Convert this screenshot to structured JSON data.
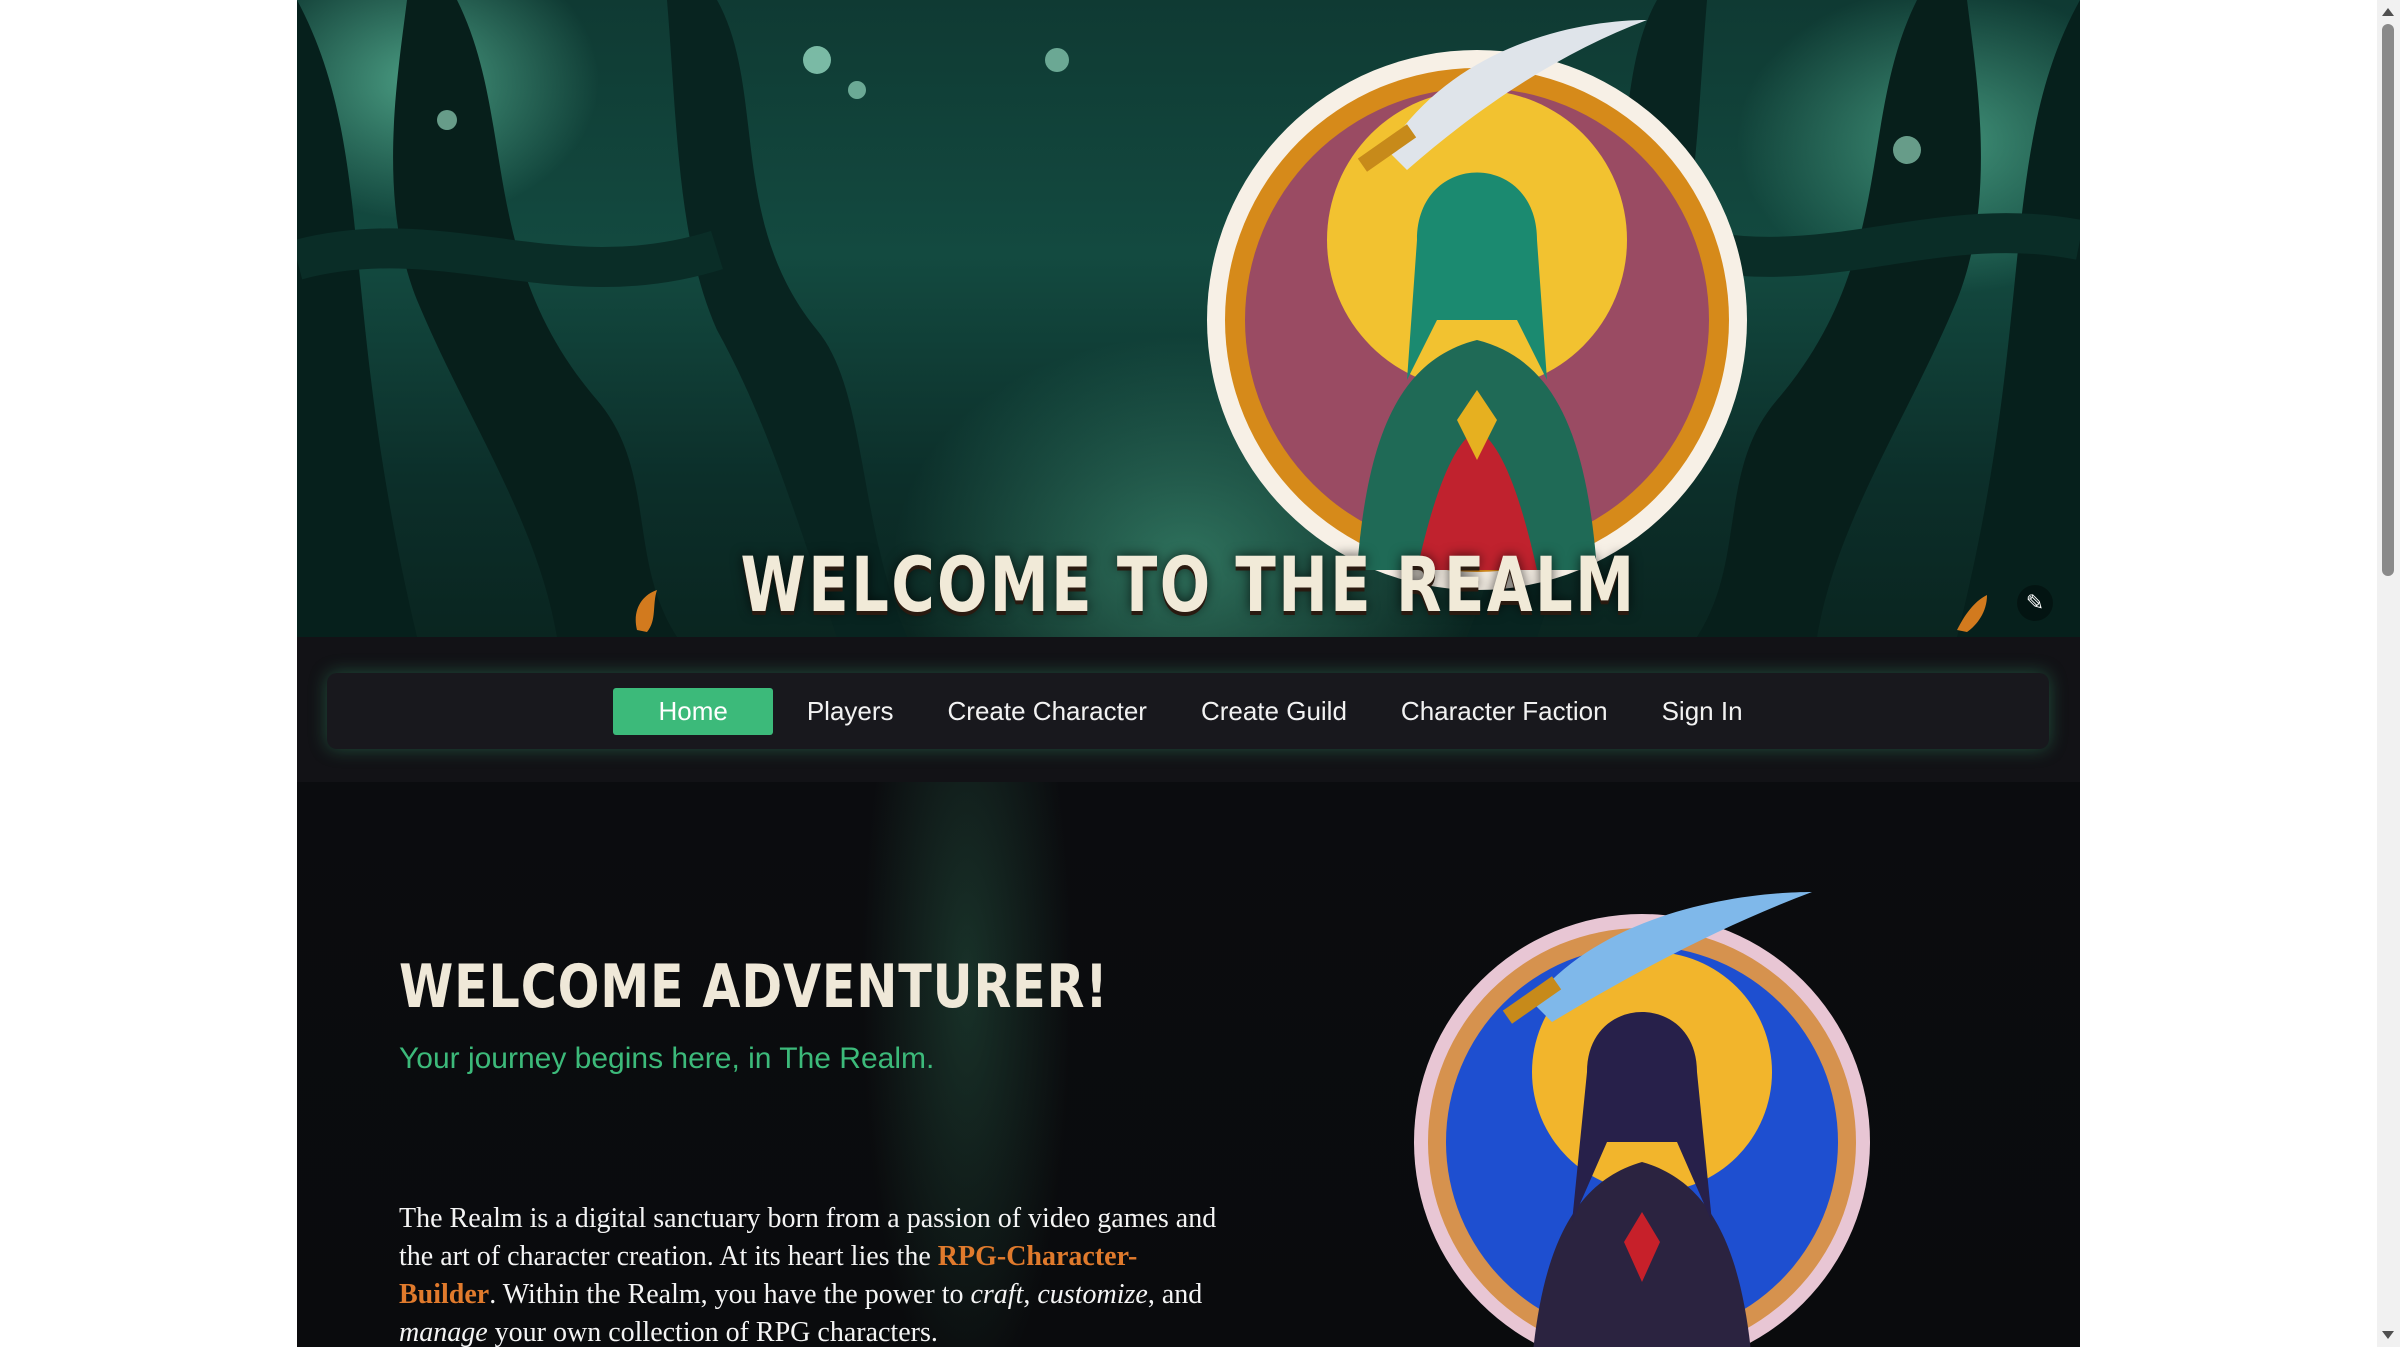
{
  "hero": {
    "title": "WELCOME TO THE REALM",
    "edit_icon": "magic-wand-icon"
  },
  "nav": {
    "items": [
      {
        "label": "Home",
        "active": true
      },
      {
        "label": "Players",
        "active": false
      },
      {
        "label": "Create Character",
        "active": false
      },
      {
        "label": "Create Guild",
        "active": false
      },
      {
        "label": "Character Faction",
        "active": false
      },
      {
        "label": "Sign In",
        "active": false
      }
    ]
  },
  "main": {
    "heading": "WELCOME ADVENTURER!",
    "subheading": "Your journey begins here, in The Realm.",
    "intro": {
      "t1": "The Realm is a digital sanctuary born from a passion of video games and the art of character creation. At its heart lies the ",
      "link": "RPG-Character-Builder",
      "t2": ". Within the Realm, you have the power to ",
      "em1": "craft",
      "t3": ", ",
      "em2": "customize",
      "t4": ", and ",
      "em3": "manage",
      "t5": " your own collection of RPG characters."
    }
  },
  "colors": {
    "accent": "#3cba7a",
    "link": "#e07a2c",
    "background": "#0b0b0e",
    "heading": "#efe8d8"
  }
}
